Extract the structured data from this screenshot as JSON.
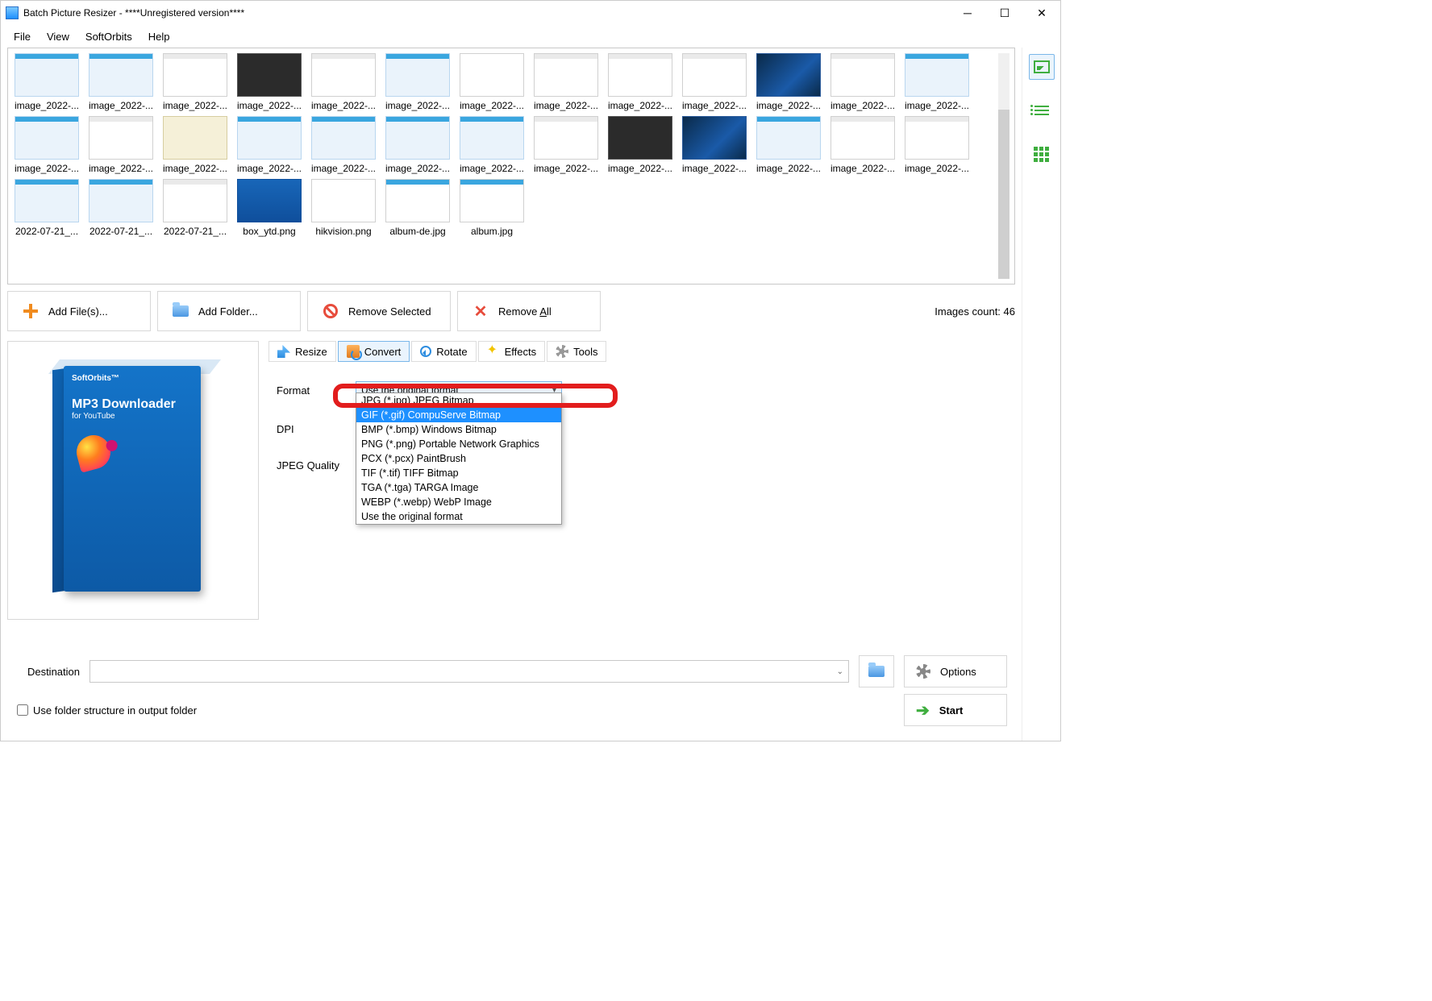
{
  "window": {
    "title": "Batch Picture Resizer - ****Unregistered version****"
  },
  "menu": {
    "file": "File",
    "view": "View",
    "softorbits": "SoftOrbits",
    "help": "Help"
  },
  "thumbs": {
    "r1": [
      "image_2022-...",
      "image_2022-...",
      "image_2022-...",
      "image_2022-...",
      "image_2022-...",
      "image_2022-...",
      "image_2022-...",
      "image_2022-...",
      "image_2022-...",
      "image_2022-...",
      "image_2022-...",
      "image_2022-...",
      "image_2022-..."
    ],
    "r2": [
      "image_2022-...",
      "image_2022-...",
      "image_2022-...",
      "image_2022-...",
      "image_2022-...",
      "image_2022-...",
      "image_2022-...",
      "image_2022-...",
      "image_2022-...",
      "image_2022-...",
      "image_2022-...",
      "image_2022-...",
      "image_2022-..."
    ],
    "r3": [
      "2022-07-21_...",
      "2022-07-21_...",
      "2022-07-21_...",
      "box_ytd.png",
      "hikvision.png",
      "album-de.jpg",
      "album.jpg"
    ]
  },
  "actions": {
    "add_files": "Add File(s)...",
    "add_folder": "Add Folder...",
    "remove_selected": "Remove Selected",
    "remove_all_pre": "Remove ",
    "remove_all_u": "A",
    "remove_all_post": "ll",
    "count": "Images count: 46"
  },
  "preview": {
    "brand": "SoftOrbits™",
    "title": "MP3 Downloader",
    "sub": "for YouTube"
  },
  "tabs": {
    "resize": "Resize",
    "convert": "Convert",
    "rotate": "Rotate",
    "effects": "Effects",
    "tools": "Tools"
  },
  "form": {
    "format": "Format",
    "dpi": "DPI",
    "jpeg": "JPEG Quality",
    "selected": "Use the original format",
    "opts": {
      "jpg": "JPG (*.jpg) JPEG Bitmap",
      "gif": "GIF (*.gif) CompuServe Bitmap",
      "bmp": "BMP (*.bmp) Windows Bitmap",
      "png": "PNG (*.png) Portable Network Graphics",
      "pcx": "PCX (*.pcx) PaintBrush",
      "tif": "TIF (*.tif) TIFF Bitmap",
      "tga": "TGA (*.tga) TARGA Image",
      "webp": "WEBP (*.webp) WebP Image",
      "orig": "Use the original format"
    }
  },
  "bottom": {
    "dest": "Destination",
    "options": "Options",
    "chk": "Use folder structure in output folder",
    "start": "Start"
  }
}
